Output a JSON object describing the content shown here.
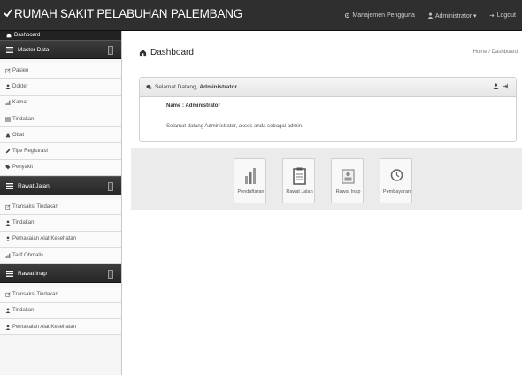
{
  "header": {
    "brand": "RUMAH SAKIT PELABUHAN PALEMBANG",
    "nav": [
      {
        "label": "Manajemen Pengguna",
        "icon": "gear-icon"
      },
      {
        "label": "Administrator ▾",
        "icon": "user-icon"
      },
      {
        "label": "Logout",
        "icon": "logout-icon"
      }
    ]
  },
  "sidebar": {
    "dashboard": "Dashboard",
    "sections": [
      {
        "title": "Master Data",
        "items": [
          {
            "label": "Pasien",
            "icon": "edit-icon"
          },
          {
            "label": "Dokter",
            "icon": "user-icon"
          },
          {
            "label": "Kamar",
            "icon": "signal-icon"
          },
          {
            "label": "Tindakan",
            "icon": "list-icon"
          },
          {
            "label": "Obat",
            "icon": "flask-icon"
          },
          {
            "label": "Tipe Registrasi",
            "icon": "pencil-icon"
          },
          {
            "label": "Penyakit",
            "icon": "tag-icon"
          }
        ]
      },
      {
        "title": "Rawat Jalan",
        "items": [
          {
            "label": "Transaksi Tindakan",
            "icon": "edit-icon"
          },
          {
            "label": "Tindakan",
            "icon": "user-icon"
          },
          {
            "label": "Pemakaian Alat Kesehatan",
            "icon": "user-icon"
          },
          {
            "label": "Tarif Obmalis",
            "icon": "signal-icon"
          }
        ]
      },
      {
        "title": "Rawat Inap",
        "items": [
          {
            "label": "Transaksi Tindakan",
            "icon": "edit-icon"
          },
          {
            "label": "Tindakan",
            "icon": "user-icon"
          },
          {
            "label": "Pemakaian Alat Kesehatan",
            "icon": "user-icon"
          }
        ]
      }
    ]
  },
  "main": {
    "title": "Dashboard",
    "breadcrumb": "Home / Dashboard",
    "welcome": {
      "greeting": "Selamat Datang,",
      "user": "Administrator",
      "name_line": "Name : Administrator",
      "description": "Selamat datang Administrator, akses anda sebagai admin."
    },
    "shortcuts": [
      {
        "label": "Pendaftaran",
        "icon": "bar-chart-icon"
      },
      {
        "label": "Rawat Jalan",
        "icon": "clipboard-icon"
      },
      {
        "label": "Rawat Inap",
        "icon": "id-card-icon"
      },
      {
        "label": "Pembayaran",
        "icon": "clock-icon"
      }
    ]
  },
  "colors": {
    "navbar": "#2f2f2f",
    "sidebar_section": "#2b2b2b",
    "band": "#ebebeb"
  }
}
